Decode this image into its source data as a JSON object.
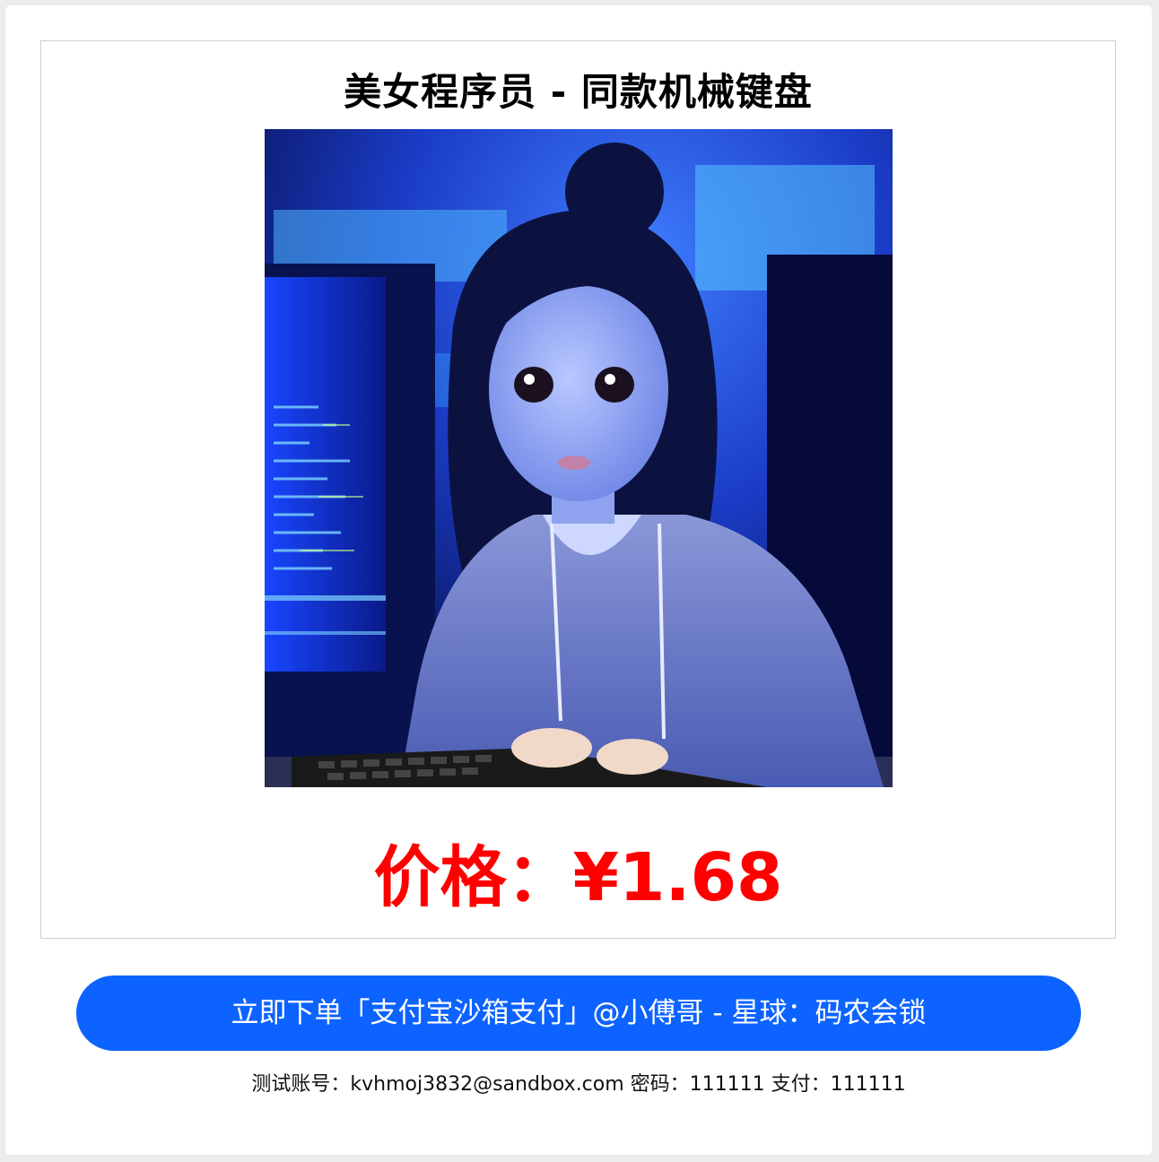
{
  "product": {
    "title": "美女程序员 - 同款机械键盘",
    "price_label": "价格：¥1.68"
  },
  "order": {
    "button_label": "立即下单「支付宝沙箱支付」@小傅哥 - 星球：码农会锁"
  },
  "account": {
    "info": "测试账号：kvhmoj3832@sandbox.com 密码：111111 支付：111111"
  },
  "colors": {
    "price": "#ff0000",
    "button": "#0d63ff",
    "button_text": "#ffffff"
  }
}
